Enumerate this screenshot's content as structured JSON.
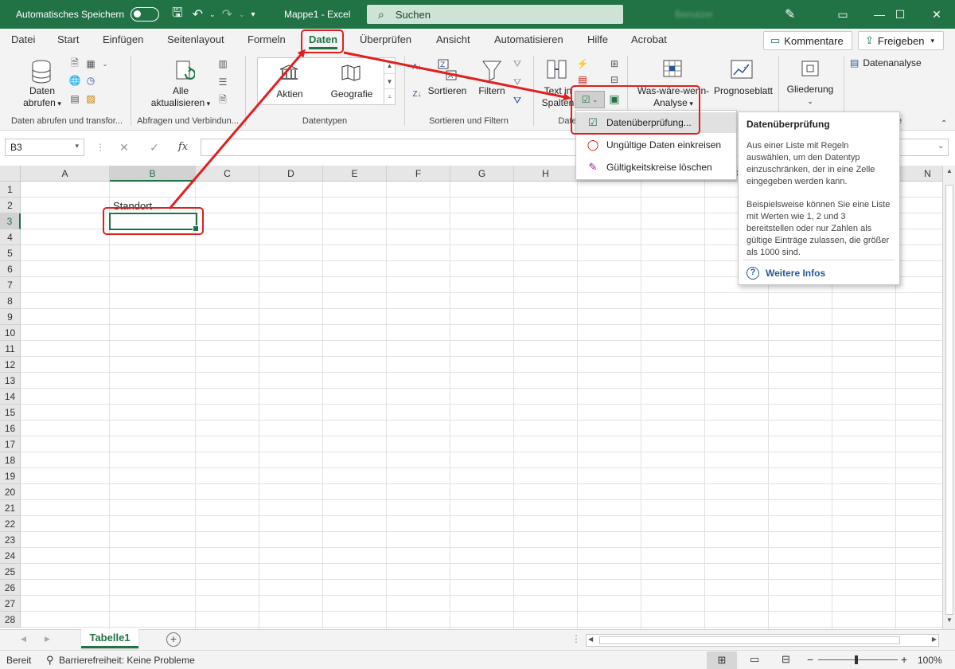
{
  "titlebar": {
    "autosave_label": "Automatisches Speichern",
    "doc_title": "Mappe1  -  Excel",
    "search_placeholder": "Suchen",
    "account_name": "Benutzer"
  },
  "menu": {
    "tabs": [
      "Datei",
      "Start",
      "Einfügen",
      "Seitenlayout",
      "Formeln",
      "Daten",
      "Überprüfen",
      "Ansicht",
      "Automatisieren",
      "Hilfe",
      "Acrobat"
    ],
    "active_tab": "Daten",
    "comments_label": "Kommentare",
    "share_label": "Freigeben"
  },
  "ribbon": {
    "get_data": {
      "line1": "Daten",
      "line2": "abrufen"
    },
    "refresh_all": {
      "line1": "Alle",
      "line2": "aktualisieren"
    },
    "datatypes": {
      "stocks": "Aktien",
      "geography": "Geografie"
    },
    "sort": "Sortieren",
    "filter": "Filtern",
    "text_to_columns": {
      "line1": "Text in",
      "line2": "Spalten"
    },
    "whatif": {
      "line1": "Was-wäre-wenn-",
      "line2": "Analyse"
    },
    "forecast": "Prognoseblatt",
    "outline": "Gliederung",
    "data_analysis": "Datenanalyse",
    "group_labels": {
      "get_transform": "Daten abrufen und transfor...",
      "queries": "Abfragen und Verbindun...",
      "datatypes": "Datentypen",
      "sort_filter": "Sortieren und Filtern",
      "datatools": "Date",
      "analysis": "e"
    }
  },
  "formula_bar": {
    "name_box": "B3",
    "fx": "fx",
    "cancel": "✕",
    "confirm": "✓",
    "content": ""
  },
  "grid": {
    "columns": [
      "A",
      "B",
      "C",
      "D",
      "E",
      "F",
      "G",
      "H",
      "I",
      "J",
      "K",
      "L",
      "M",
      "N"
    ],
    "rows": [
      "1",
      "2",
      "3",
      "4",
      "5",
      "6",
      "7",
      "8",
      "9",
      "10",
      "11",
      "12",
      "13",
      "14",
      "15",
      "16",
      "17",
      "18",
      "19",
      "20",
      "21",
      "22",
      "23",
      "24",
      "25",
      "26",
      "27",
      "28"
    ],
    "cell_b2": "Standort",
    "selected_cell": "B3"
  },
  "dropdown": {
    "items": [
      "Datenüberprüfung...",
      "Ungültige Daten einkreisen",
      "Gültigkeitskreise löschen"
    ]
  },
  "tooltip": {
    "title": "Datenüberprüfung",
    "p1": "Aus einer Liste mit Regeln auswählen, um den Datentyp einzuschränken, der in eine Zelle eingegeben werden kann.",
    "p2": "Beispielsweise können Sie eine Liste mit Werten wie 1, 2 und 3 bereitstellen oder nur Zahlen als gültige Einträge zulassen, die größer als 1000 sind.",
    "link": "Weitere Infos"
  },
  "sheets": {
    "active": "Tabelle1",
    "add": "+"
  },
  "status": {
    "ready": "Bereit",
    "accessibility": "Barrierefreiheit: Keine Probleme",
    "zoom_minus": "−",
    "zoom_plus": "+",
    "zoom": "100%"
  },
  "colors": {
    "excel_green": "#217346",
    "annotation_red": "#e02020"
  }
}
